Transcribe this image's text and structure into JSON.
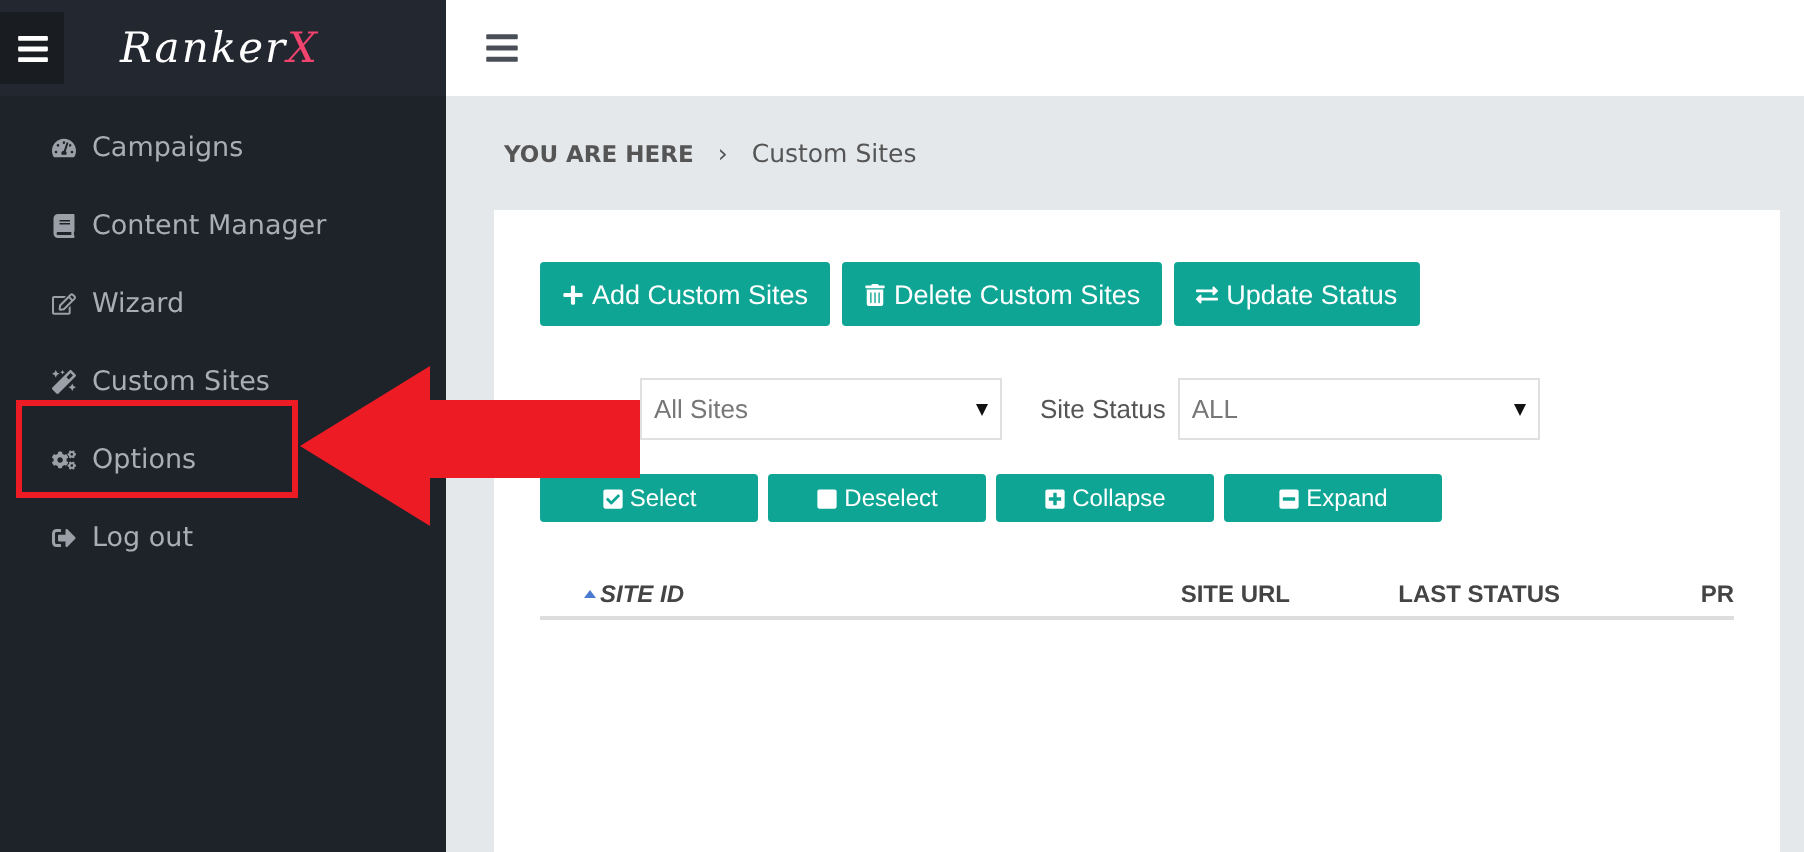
{
  "sidebar": {
    "logo": {
      "text": "Ranker",
      "accent": "X"
    },
    "items": [
      {
        "label": "Campaigns",
        "selected": false
      },
      {
        "label": "Content Manager",
        "selected": false
      },
      {
        "label": "Wizard",
        "selected": false
      },
      {
        "label": "Custom Sites",
        "selected": false
      },
      {
        "label": "Options",
        "selected": false
      },
      {
        "label": "Log out",
        "selected": false
      }
    ]
  },
  "breadcrumb": {
    "prefix": "YOU ARE HERE",
    "separator": "›",
    "current": "Custom Sites"
  },
  "actions": [
    {
      "label": "Add Custom Sites"
    },
    {
      "label": "Delete Custom Sites"
    },
    {
      "label": "Update Status"
    }
  ],
  "filters": [
    {
      "value": "All Sites"
    },
    {
      "label": "Site Status",
      "value": "ALL"
    }
  ],
  "tools": [
    {
      "label": "Select"
    },
    {
      "label": "Deselect"
    },
    {
      "label": "Collapse"
    },
    {
      "label": "Expand"
    }
  ],
  "table": {
    "columns": [
      {
        "label": "SITE ID",
        "sorted": true
      },
      {
        "label": "SITE URL",
        "sorted": false
      },
      {
        "label": "LAST STATUS",
        "sorted": false
      },
      {
        "label": "PR",
        "sorted": false
      }
    ]
  }
}
